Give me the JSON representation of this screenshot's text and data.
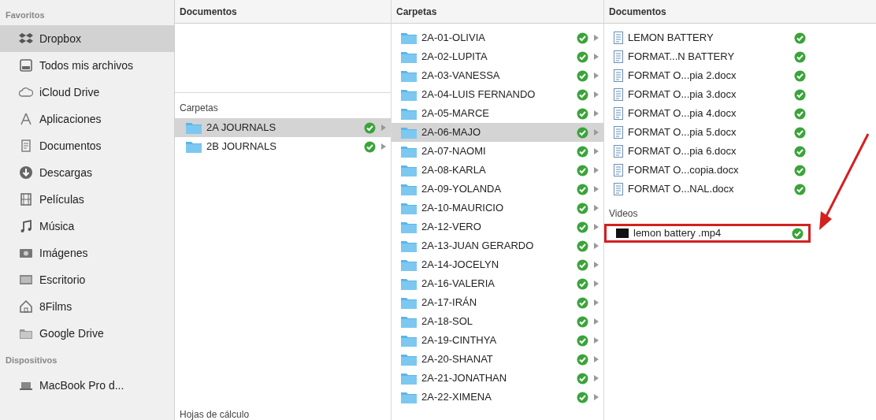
{
  "sidebar": {
    "sections": [
      {
        "title": "Favoritos",
        "items": [
          {
            "label": "Dropbox",
            "selected": true
          },
          {
            "label": "Todos mis archivos",
            "selected": false
          },
          {
            "label": "iCloud Drive",
            "selected": false
          },
          {
            "label": "Aplicaciones",
            "selected": false
          },
          {
            "label": "Documentos",
            "selected": false
          },
          {
            "label": "Descargas",
            "selected": false
          },
          {
            "label": "Películas",
            "selected": false
          },
          {
            "label": "Música",
            "selected": false
          },
          {
            "label": "Imágenes",
            "selected": false
          },
          {
            "label": "Escritorio",
            "selected": false
          },
          {
            "label": "8Films",
            "selected": false
          },
          {
            "label": "Google Drive",
            "selected": false
          }
        ]
      },
      {
        "title": "Dispositivos",
        "items": [
          {
            "label": "MacBook Pro d...",
            "selected": false
          }
        ]
      }
    ]
  },
  "columns": [
    {
      "header": "Documentos",
      "groups": [
        {
          "title": "Carpetas",
          "items": [
            {
              "name": "2A JOURNALS",
              "kind": "folder",
              "selected": true,
              "synced": true
            },
            {
              "name": "2B JOURNALS",
              "kind": "folder",
              "selected": false,
              "synced": true
            }
          ]
        },
        {
          "title": "Hojas de cálculo"
        }
      ]
    },
    {
      "header": "Carpetas",
      "groups": [
        {
          "items": [
            {
              "name": "2A-01-OLIVIA",
              "kind": "folder",
              "selected": false,
              "synced": true
            },
            {
              "name": "2A-02-LUPITA",
              "kind": "folder",
              "selected": false,
              "synced": true
            },
            {
              "name": "2A-03-VANESSA",
              "kind": "folder",
              "selected": false,
              "synced": true
            },
            {
              "name": "2A-04-LUIS FERNANDO",
              "kind": "folder",
              "selected": false,
              "synced": true
            },
            {
              "name": "2A-05-MARCE",
              "kind": "folder",
              "selected": false,
              "synced": true
            },
            {
              "name": "2A-06-MAJO",
              "kind": "folder",
              "selected": true,
              "synced": true
            },
            {
              "name": "2A-07-NAOMI",
              "kind": "folder",
              "selected": false,
              "synced": true
            },
            {
              "name": "2A-08-KARLA",
              "kind": "folder",
              "selected": false,
              "synced": true
            },
            {
              "name": "2A-09-YOLANDA",
              "kind": "folder",
              "selected": false,
              "synced": true
            },
            {
              "name": "2A-10-MAURICIO",
              "kind": "folder",
              "selected": false,
              "synced": true
            },
            {
              "name": "2A-12-VERO",
              "kind": "folder",
              "selected": false,
              "synced": true
            },
            {
              "name": "2A-13-JUAN GERARDO",
              "kind": "folder",
              "selected": false,
              "synced": true
            },
            {
              "name": "2A-14-JOCELYN",
              "kind": "folder",
              "selected": false,
              "synced": true
            },
            {
              "name": "2A-16-VALERIA",
              "kind": "folder",
              "selected": false,
              "synced": true
            },
            {
              "name": "2A-17-IRÁN",
              "kind": "folder",
              "selected": false,
              "synced": true
            },
            {
              "name": "2A-18-SOL",
              "kind": "folder",
              "selected": false,
              "synced": true
            },
            {
              "name": "2A-19-CINTHYA",
              "kind": "folder",
              "selected": false,
              "synced": true
            },
            {
              "name": "2A-20-SHANAT",
              "kind": "folder",
              "selected": false,
              "synced": true
            },
            {
              "name": "2A-21-JONATHAN",
              "kind": "folder",
              "selected": false,
              "synced": true
            },
            {
              "name": "2A-22-XIMENA",
              "kind": "folder",
              "selected": false,
              "synced": true
            }
          ]
        }
      ]
    },
    {
      "header": "Documentos",
      "groups": [
        {
          "items": [
            {
              "name": "LEMON BATTERY",
              "kind": "document",
              "selected": false,
              "synced": true
            },
            {
              "name": "FORMAT...N BATTERY",
              "kind": "document",
              "selected": false,
              "synced": true
            },
            {
              "name": "FORMAT O...pia 2.docx",
              "kind": "document",
              "selected": false,
              "synced": true
            },
            {
              "name": "FORMAT O...pia 3.docx",
              "kind": "document",
              "selected": false,
              "synced": true
            },
            {
              "name": "FORMAT O...pia 4.docx",
              "kind": "document",
              "selected": false,
              "synced": true
            },
            {
              "name": "FORMAT O...pia 5.docx",
              "kind": "document",
              "selected": false,
              "synced": true
            },
            {
              "name": "FORMAT O...pia 6.docx",
              "kind": "document",
              "selected": false,
              "synced": true
            },
            {
              "name": "FORMAT O...copia.docx",
              "kind": "document",
              "selected": false,
              "synced": true
            },
            {
              "name": "FORMAT O...NAL.docx",
              "kind": "document",
              "selected": false,
              "synced": true
            }
          ]
        },
        {
          "title": "Videos",
          "items": [
            {
              "name": "lemon battery .mp4",
              "kind": "video",
              "selected": false,
              "synced": true,
              "highlighted": true
            }
          ]
        }
      ]
    }
  ]
}
